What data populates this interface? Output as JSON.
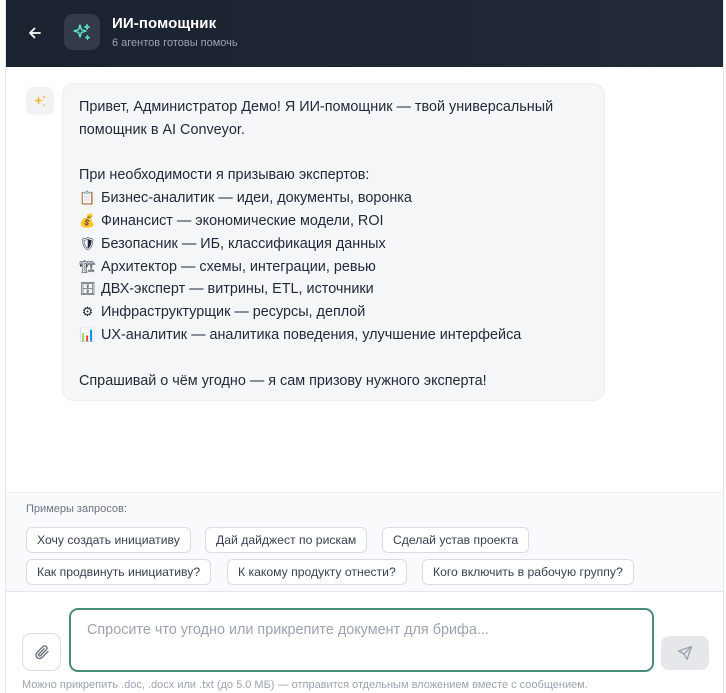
{
  "header": {
    "back_icon": "arrow-left-icon",
    "logo_icon": "sparkles-icon",
    "title": "ИИ-помощник",
    "subtitle": "6 агентов готовы помочь"
  },
  "message": {
    "avatar_icon": "sparkles-icon",
    "intro_line1": "Привет, Администратор Демо! Я ИИ-помощник — твой универсальный",
    "intro_line2": "помощник в AI Conveyor.",
    "experts_heading": "При необходимости я призываю экспертов:",
    "experts": [
      {
        "emoji": "📋",
        "text": "Бизнес-аналитик — идеи, документы, воронка"
      },
      {
        "emoji": "💰",
        "text": "Финансист — экономические модели, ROI"
      },
      {
        "emoji": "🛡",
        "text": "Безопасник — ИБ, классификация данных"
      },
      {
        "emoji": "🏗",
        "text": "Архитектор — схемы, интеграции, ревью"
      },
      {
        "emoji": "🗄",
        "text": "ДВХ-эксперт — витрины, ETL, источники"
      },
      {
        "emoji": "⚙",
        "text": "Инфраструктурщик — ресурсы, деплой"
      },
      {
        "emoji": "📊",
        "text": "UX-аналитик — аналитика поведения, улучшение интерфейса"
      }
    ],
    "closing": "Спрашивай о чём угодно — я сам призову нужного эксперта!"
  },
  "examples": {
    "label": "Примеры запросов:",
    "chips": [
      "Хочу создать инициативу",
      "Дай дайджест по рискам",
      "Сделай устав проекта",
      "Как продвинуть инициативу?",
      "К какому продукту отнести?",
      "Кого включить в рабочую группу?"
    ]
  },
  "composer": {
    "attach_icon": "paperclip-icon",
    "placeholder": "Спросите что угодно или прикрепите документ для брифа...",
    "value": "",
    "send_icon": "send-icon",
    "hint": "Можно прикрепить .doc, .docx или .txt (до 5.0 МБ) — отправится отдельным вложением вместе с сообщением."
  },
  "colors": {
    "header_bg": "#1b2230",
    "accent": "#4a8c7a",
    "sparkle_teal": "#5eead4",
    "sparkle_amber": "#f5b942"
  }
}
